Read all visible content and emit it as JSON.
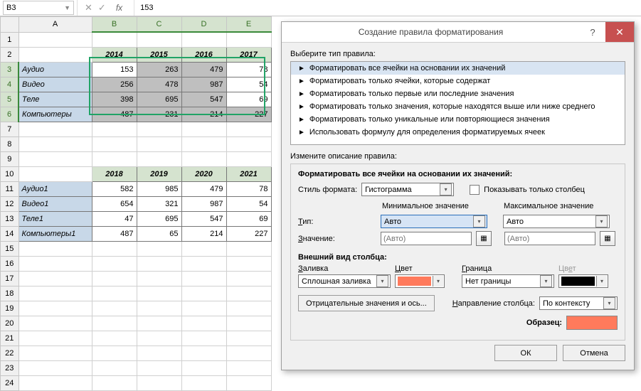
{
  "formulaBar": {
    "nameBox": "B3",
    "fx": "fx",
    "value": "153"
  },
  "cols": [
    "A",
    "B",
    "C",
    "D",
    "E"
  ],
  "rows": 24,
  "selectedRows": [
    3,
    4,
    5,
    6
  ],
  "selectedCols": [
    "B",
    "C",
    "D",
    "E"
  ],
  "table1": {
    "headers": [
      "2014",
      "2015",
      "2016",
      "2017"
    ],
    "rows": [
      {
        "label": "Аудио",
        "v": [
          "153",
          "263",
          "479",
          "78"
        ]
      },
      {
        "label": "Видео",
        "v": [
          "256",
          "478",
          "987",
          "54"
        ]
      },
      {
        "label": "Теле",
        "v": [
          "398",
          "695",
          "547",
          "69"
        ]
      },
      {
        "label": "Компьютеры",
        "v": [
          "487",
          "231",
          "214",
          "227"
        ]
      }
    ]
  },
  "table2": {
    "headers": [
      "2018",
      "2019",
      "2020",
      "2021"
    ],
    "rows": [
      {
        "label": "Аудио1",
        "v": [
          "582",
          "985",
          "479",
          "78"
        ]
      },
      {
        "label": "Видео1",
        "v": [
          "654",
          "321",
          "987",
          "54"
        ]
      },
      {
        "label": "Теле1",
        "v": [
          "47",
          "695",
          "547",
          "69"
        ]
      },
      {
        "label": "Компьютеры1",
        "v": [
          "487",
          "65",
          "214",
          "227"
        ]
      }
    ]
  },
  "dialog": {
    "title": "Создание правила форматирования",
    "sectionRuleType": "Выберите тип правила:",
    "ruleTypes": [
      "Форматировать все ячейки на основании их значений",
      "Форматировать только ячейки, которые содержат",
      "Форматировать только первые или последние значения",
      "Форматировать только значения, которые находятся выше или ниже среднего",
      "Форматировать только уникальные или повторяющиеся значения",
      "Использовать формулу для определения форматируемых ячеек"
    ],
    "sectionDesc": "Измените описание правила:",
    "descTitle": "Форматировать все ячейки на основании их значений:",
    "styleLabel": "Стиль формата:",
    "styleValue": "Гистограмма",
    "showBarOnly": "Показывать только столбец",
    "minLabel": "Минимальное значение",
    "maxLabel": "Максимальное значение",
    "typeLabel": "Тип:",
    "typeMin": "Авто",
    "typeMax": "Авто",
    "valueLabel": "Значение:",
    "valuePlaceholder": "(Авто)",
    "appearance": "Внешний вид столбца:",
    "fillLabel": "Заливка",
    "fillValue": "Сплошная заливка",
    "colorLabel": "Цвет",
    "fillColor": "#ff7a5c",
    "borderLabel": "Граница",
    "borderValue": "Нет границы",
    "borderColor": "#000000",
    "negBtn": "Отрицательные значения и ось...",
    "dirLabel": "Направление столбца:",
    "dirValue": "По контексту",
    "sampleLabel": "Образец:",
    "ok": "ОК",
    "cancel": "Отмена"
  }
}
